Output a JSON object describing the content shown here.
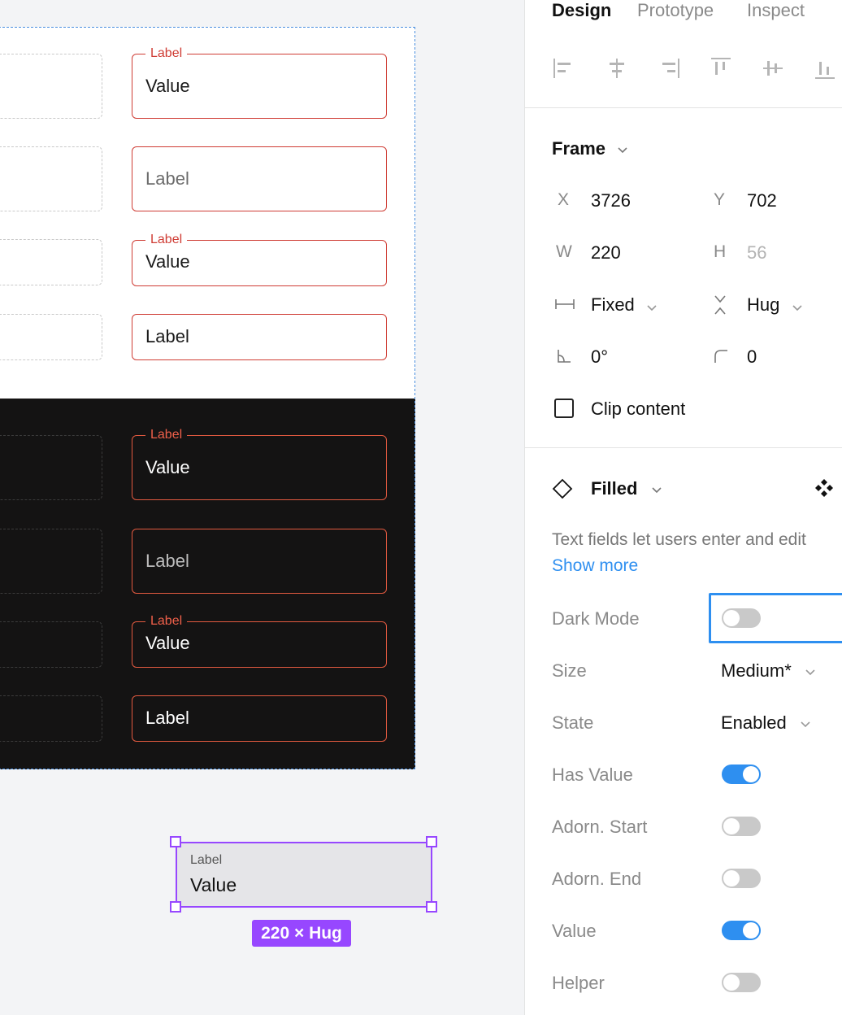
{
  "canvas": {
    "light_fields": [
      {
        "label": "Label",
        "value": "Value"
      },
      {
        "placeholder": "Label"
      },
      {
        "label": "Label",
        "value": "Value"
      },
      {
        "value": "Label"
      }
    ],
    "dark_fields": [
      {
        "label": "Label",
        "value": "Value"
      },
      {
        "placeholder": "Label"
      },
      {
        "label": "Label",
        "value": "Value"
      },
      {
        "value": "Label"
      }
    ],
    "selected": {
      "label": "Label",
      "value": "Value",
      "size_badge": "220 × Hug"
    }
  },
  "panel": {
    "tabs": [
      "Design",
      "Prototype",
      "Inspect"
    ],
    "frame": {
      "title": "Frame",
      "x_key": "X",
      "x": "3726",
      "y_key": "Y",
      "y": "702",
      "w_key": "W",
      "w": "220",
      "h_key": "H",
      "h": "56",
      "width_mode": "Fixed",
      "height_mode": "Hug",
      "rotation": "0°",
      "radius": "0",
      "clip_content": "Clip content"
    },
    "component": {
      "name": "Filled",
      "description": "Text fields let users enter and edit",
      "show_more": "Show more",
      "props": [
        {
          "label": "Dark Mode",
          "type": "toggle",
          "on": false
        },
        {
          "label": "Size",
          "type": "dropdown",
          "value": "Medium*"
        },
        {
          "label": "State",
          "type": "dropdown",
          "value": "Enabled"
        },
        {
          "label": "Has Value",
          "type": "toggle",
          "on": true
        },
        {
          "label": "Adorn. Start",
          "type": "toggle",
          "on": false
        },
        {
          "label": "Adorn. End",
          "type": "toggle",
          "on": false
        },
        {
          "label": "Value",
          "type": "toggle",
          "on": true
        },
        {
          "label": "Helper",
          "type": "toggle",
          "on": false
        }
      ]
    }
  },
  "colors": {
    "accent_blue": "#2e8ff0",
    "selection_purple": "#9747ff",
    "error_red": "#cf3c34",
    "dark_bg": "#141313"
  }
}
